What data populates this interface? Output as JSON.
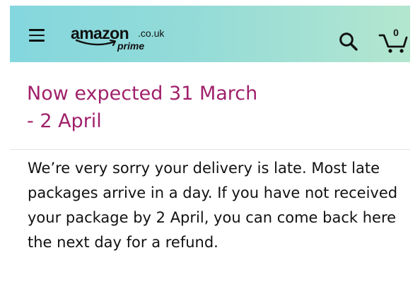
{
  "header": {
    "menu_icon": "hamburger-menu-icon",
    "logo": {
      "wordmark": "amazon",
      "domain": ".co.uk",
      "subbrand": "prime"
    },
    "search_icon": "search-icon",
    "cart": {
      "icon": "cart-icon",
      "count": "0"
    },
    "gradient_colors": [
      "#84d7de",
      "#b3e6cf"
    ]
  },
  "delivery": {
    "heading": "Now expected 31 March - 2 April",
    "heading_line1": "Now expected 31 March",
    "heading_line2": "- 2 April",
    "heading_color": "#a0216b",
    "message": "We’re very sorry your delivery is late. Most late packages arrive in a day. If you have not received your package by 2 April, you can come back here the next day for a refund."
  }
}
